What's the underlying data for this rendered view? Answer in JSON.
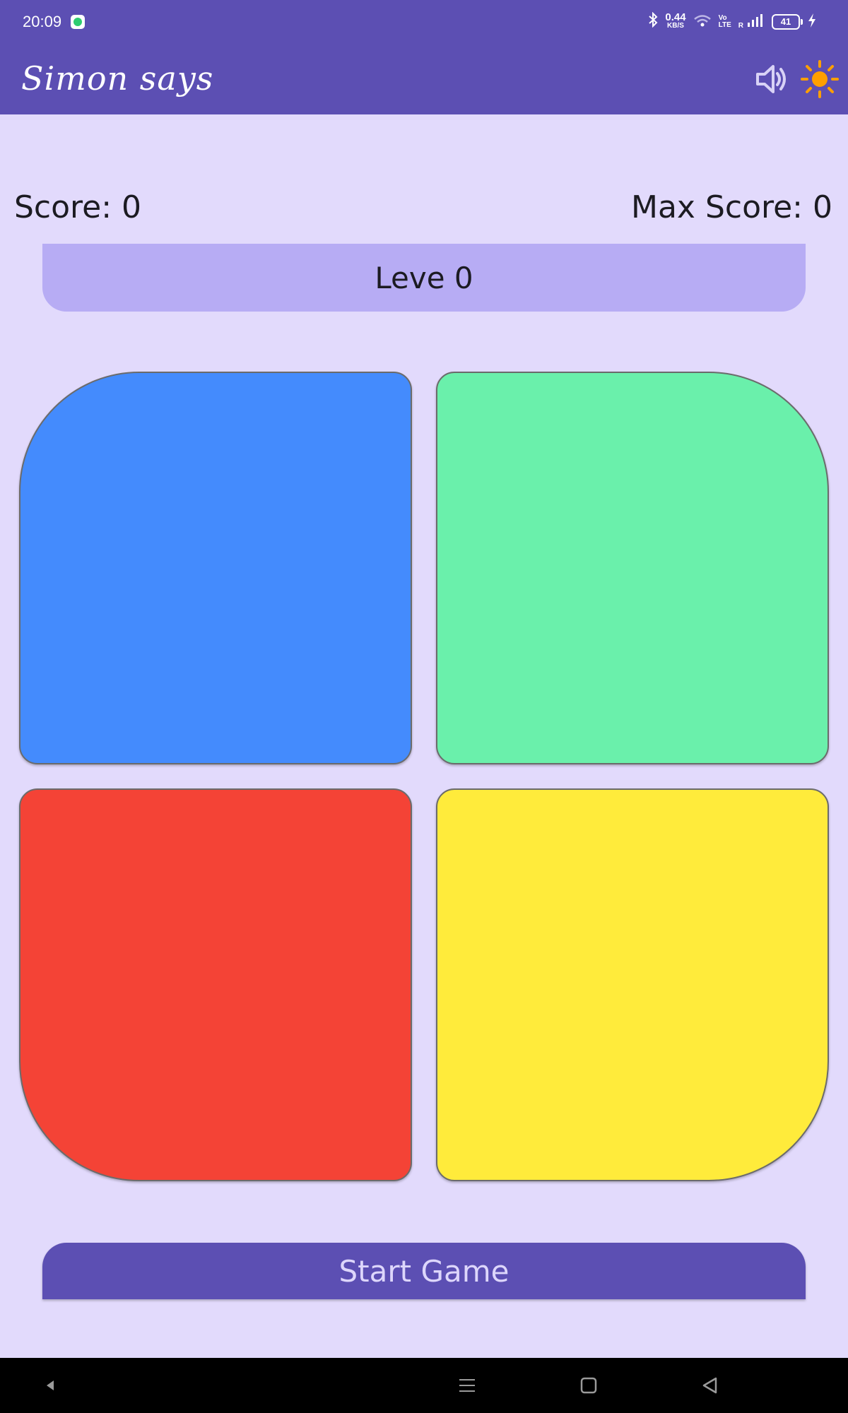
{
  "status_bar": {
    "time": "20:09",
    "net_speed": "0.44",
    "net_unit": "KB/S",
    "volte_top": "Vo",
    "volte_bottom": "LTE",
    "roaming": "R",
    "battery": "41"
  },
  "app_bar": {
    "title": "Simon says",
    "sound_icon": "volume-up-icon",
    "theme_icon": "sun-icon",
    "theme_icon_color": "#ff9f00"
  },
  "scores": {
    "score": "Score: 0",
    "max_score": "Max Score: 0"
  },
  "level": {
    "label": "Leve 0"
  },
  "pads": [
    {
      "name": "blue",
      "color": "#448bfd"
    },
    {
      "name": "green",
      "color": "#6af0ab"
    },
    {
      "name": "red",
      "color": "#f44336"
    },
    {
      "name": "yellow",
      "color": "#ffeb3b"
    }
  ],
  "start_button": {
    "label": "Start Game"
  },
  "colors": {
    "primary": "#5c4fb3",
    "background": "#e2dafc",
    "level_banner": "#b7acf4"
  }
}
